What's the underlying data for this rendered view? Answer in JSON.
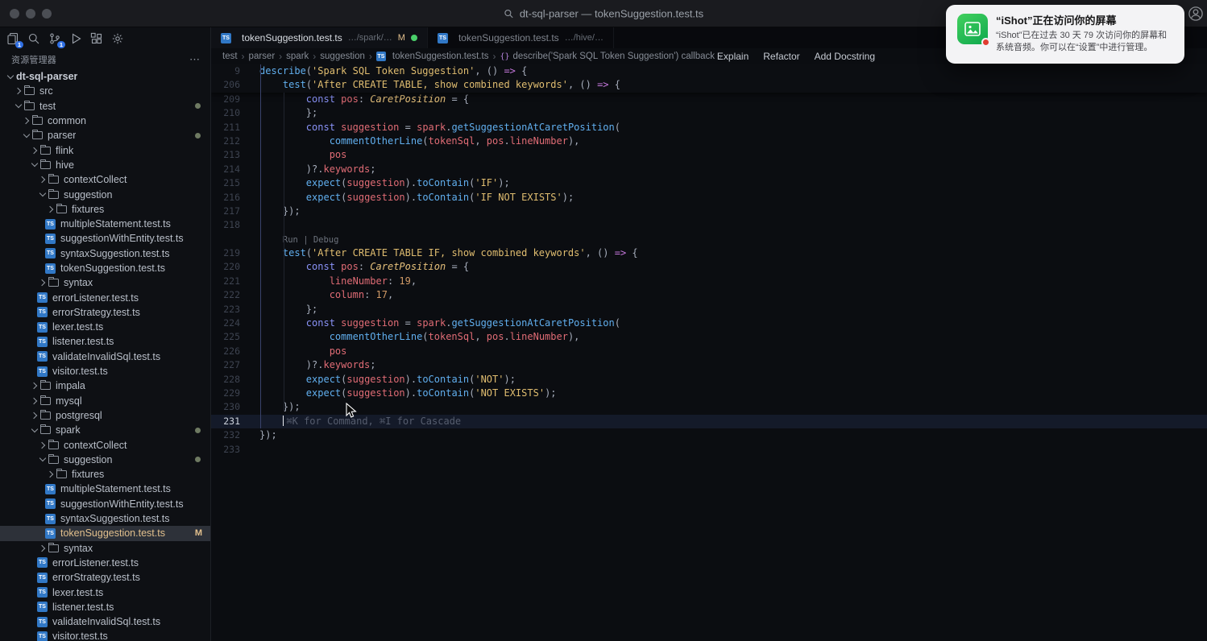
{
  "window": {
    "title": "dt-sql-parser — tokenSuggestion.test.ts"
  },
  "icons": {
    "ts_label": "TS"
  },
  "colors": {
    "accent_blue": "#2f6fe4",
    "git_modified": "#e2c08d",
    "unsaved_dot": "#4ad06a",
    "string": "#e0bd70",
    "keyword": "#8a93f8",
    "function": "#61afef",
    "variable": "#e06c75",
    "number": "#d19a66",
    "type": "#e5c07b"
  },
  "notification": {
    "title": "“iShot”正在访问你的屏幕",
    "body": "“iShot”已在过去 30 天 79 次访问你的屏幕和系统音频。你可以在“设置”中进行管理。"
  },
  "activity": {
    "icons": [
      {
        "name": "explorer-icon",
        "badge": "1"
      },
      {
        "name": "search-icon"
      },
      {
        "name": "source-control-icon",
        "badge": "1"
      },
      {
        "name": "run-debug-icon"
      },
      {
        "name": "extensions-icon"
      },
      {
        "name": "settings-icon"
      }
    ]
  },
  "sidebar": {
    "header": "资源管理器",
    "more_label": "⋯",
    "tree": [
      {
        "d": 0,
        "k": "root",
        "o": true,
        "label": "dt-sql-parser"
      },
      {
        "d": 1,
        "k": "dir",
        "o": false,
        "label": "src"
      },
      {
        "d": 1,
        "k": "dir",
        "o": true,
        "label": "test",
        "dot": true
      },
      {
        "d": 2,
        "k": "dir",
        "o": false,
        "label": "common"
      },
      {
        "d": 2,
        "k": "dir",
        "o": true,
        "label": "parser",
        "dot": true
      },
      {
        "d": 3,
        "k": "dir",
        "o": false,
        "label": "flink"
      },
      {
        "d": 3,
        "k": "dir",
        "o": true,
        "label": "hive"
      },
      {
        "d": 4,
        "k": "dir",
        "o": false,
        "label": "contextCollect"
      },
      {
        "d": 4,
        "k": "dir",
        "o": true,
        "label": "suggestion"
      },
      {
        "d": 5,
        "k": "dir",
        "o": false,
        "label": "fixtures"
      },
      {
        "d": 5,
        "k": "file",
        "label": "multipleStatement.test.ts"
      },
      {
        "d": 5,
        "k": "file",
        "label": "suggestionWithEntity.test.ts"
      },
      {
        "d": 5,
        "k": "file",
        "label": "syntaxSuggestion.test.ts"
      },
      {
        "d": 5,
        "k": "file",
        "label": "tokenSuggestion.test.ts"
      },
      {
        "d": 4,
        "k": "dir",
        "o": false,
        "label": "syntax"
      },
      {
        "d": 4,
        "k": "file",
        "label": "errorListener.test.ts"
      },
      {
        "d": 4,
        "k": "file",
        "label": "errorStrategy.test.ts"
      },
      {
        "d": 4,
        "k": "file",
        "label": "lexer.test.ts"
      },
      {
        "d": 4,
        "k": "file",
        "label": "listener.test.ts"
      },
      {
        "d": 4,
        "k": "file",
        "label": "validateInvalidSql.test.ts"
      },
      {
        "d": 4,
        "k": "file",
        "label": "visitor.test.ts"
      },
      {
        "d": 3,
        "k": "dir",
        "o": false,
        "label": "impala"
      },
      {
        "d": 3,
        "k": "dir",
        "o": false,
        "label": "mysql"
      },
      {
        "d": 3,
        "k": "dir",
        "o": false,
        "label": "postgresql"
      },
      {
        "d": 3,
        "k": "dir",
        "o": true,
        "label": "spark",
        "dot": true
      },
      {
        "d": 4,
        "k": "dir",
        "o": false,
        "label": "contextCollect"
      },
      {
        "d": 4,
        "k": "dir",
        "o": true,
        "label": "suggestion",
        "dot": true
      },
      {
        "d": 5,
        "k": "dir",
        "o": false,
        "label": "fixtures"
      },
      {
        "d": 5,
        "k": "file",
        "label": "multipleStatement.test.ts"
      },
      {
        "d": 5,
        "k": "file",
        "label": "suggestionWithEntity.test.ts"
      },
      {
        "d": 5,
        "k": "file",
        "label": "syntaxSuggestion.test.ts"
      },
      {
        "d": 5,
        "k": "file",
        "label": "tokenSuggestion.test.ts",
        "sel": true,
        "mod": true,
        "badge": "M"
      },
      {
        "d": 4,
        "k": "dir",
        "o": false,
        "label": "syntax"
      },
      {
        "d": 4,
        "k": "file",
        "label": "errorListener.test.ts"
      },
      {
        "d": 4,
        "k": "file",
        "label": "errorStrategy.test.ts"
      },
      {
        "d": 4,
        "k": "file",
        "label": "lexer.test.ts"
      },
      {
        "d": 4,
        "k": "file",
        "label": "listener.test.ts"
      },
      {
        "d": 4,
        "k": "file",
        "label": "validateInvalidSql.test.ts"
      },
      {
        "d": 4,
        "k": "file",
        "label": "visitor.test.ts"
      }
    ]
  },
  "tabs": [
    {
      "label": "tokenSuggestion.test.ts",
      "path": "…/spark/…",
      "git": "M",
      "dirty": true,
      "active": true
    },
    {
      "label": "tokenSuggestion.test.ts",
      "path": "…/hive/…",
      "active": false
    }
  ],
  "breadcrumbs": {
    "separator": "›",
    "items": [
      {
        "label": "test"
      },
      {
        "label": "parser"
      },
      {
        "label": "spark"
      },
      {
        "label": "suggestion"
      },
      {
        "label": "tokenSuggestion.test.ts",
        "icon": "ts"
      },
      {
        "label": "describe('Spark SQL Token Suggestion') callback",
        "icon": "symbol"
      }
    ],
    "actions": [
      "Explain",
      "Refactor",
      "Add Docstring"
    ]
  },
  "editor": {
    "sticky": [
      {
        "n": "9",
        "tokens": [
          [
            "f",
            "describe"
          ],
          [
            "p",
            "("
          ],
          [
            "s",
            "'Spark SQL Token Suggestion'"
          ],
          [
            "p",
            ", () "
          ],
          [
            "a",
            "=>"
          ],
          [
            "p",
            " {"
          ]
        ]
      },
      {
        "n": "206",
        "tokens": [
          [
            "p",
            "    "
          ],
          [
            "f",
            "test"
          ],
          [
            "p",
            "("
          ],
          [
            "s",
            "'After CREATE TABLE, show combined keywords'"
          ],
          [
            "p",
            ", () "
          ],
          [
            "a",
            "=>"
          ],
          [
            "p",
            " {"
          ]
        ]
      }
    ],
    "lines": [
      {
        "n": "209",
        "tokens": [
          [
            "p",
            "        "
          ],
          [
            "k",
            "const"
          ],
          [
            "p",
            " "
          ],
          [
            "v",
            "pos"
          ],
          [
            "p",
            ": "
          ],
          [
            "t",
            "CaretPosition"
          ],
          [
            "p",
            " = {"
          ]
        ]
      },
      {
        "n": "210",
        "tokens": [
          [
            "p",
            "        };"
          ]
        ]
      },
      {
        "n": "211",
        "tokens": [
          [
            "p",
            "        "
          ],
          [
            "k",
            "const"
          ],
          [
            "p",
            " "
          ],
          [
            "v",
            "suggestion"
          ],
          [
            "p",
            " = "
          ],
          [
            "v",
            "spark"
          ],
          [
            "p",
            "."
          ],
          [
            "f",
            "getSuggestionAtCaretPosition"
          ],
          [
            "p",
            "("
          ]
        ]
      },
      {
        "n": "212",
        "tokens": [
          [
            "p",
            "            "
          ],
          [
            "f",
            "commentOtherLine"
          ],
          [
            "p",
            "("
          ],
          [
            "v",
            "tokenSql"
          ],
          [
            "p",
            ", "
          ],
          [
            "v",
            "pos"
          ],
          [
            "p",
            "."
          ],
          [
            "v",
            "lineNumber"
          ],
          [
            "p",
            "),"
          ]
        ]
      },
      {
        "n": "213",
        "tokens": [
          [
            "p",
            "            "
          ],
          [
            "v",
            "pos"
          ]
        ]
      },
      {
        "n": "214",
        "tokens": [
          [
            "p",
            "        )?."
          ],
          [
            "v",
            "keywords"
          ],
          [
            "p",
            ";"
          ]
        ]
      },
      {
        "n": "215",
        "tokens": [
          [
            "p",
            "        "
          ],
          [
            "f",
            "expect"
          ],
          [
            "p",
            "("
          ],
          [
            "v",
            "suggestion"
          ],
          [
            "p",
            ")."
          ],
          [
            "f",
            "toContain"
          ],
          [
            "p",
            "("
          ],
          [
            "s",
            "'IF'"
          ],
          [
            "p",
            ");"
          ]
        ]
      },
      {
        "n": "216",
        "tokens": [
          [
            "p",
            "        "
          ],
          [
            "f",
            "expect"
          ],
          [
            "p",
            "("
          ],
          [
            "v",
            "suggestion"
          ],
          [
            "p",
            ")."
          ],
          [
            "f",
            "toContain"
          ],
          [
            "p",
            "("
          ],
          [
            "s",
            "'IF NOT EXISTS'"
          ],
          [
            "p",
            ");"
          ]
        ]
      },
      {
        "n": "217",
        "tokens": [
          [
            "p",
            "    });"
          ]
        ]
      },
      {
        "n": "218",
        "tokens": []
      },
      {
        "lens": "Run | Debug"
      },
      {
        "n": "219",
        "tokens": [
          [
            "p",
            "    "
          ],
          [
            "f",
            "test"
          ],
          [
            "p",
            "("
          ],
          [
            "s",
            "'After CREATE TABLE IF, show combined keywords'"
          ],
          [
            "p",
            ", () "
          ],
          [
            "a",
            "=>"
          ],
          [
            "p",
            " {"
          ]
        ]
      },
      {
        "n": "220",
        "tokens": [
          [
            "p",
            "        "
          ],
          [
            "k",
            "const"
          ],
          [
            "p",
            " "
          ],
          [
            "v",
            "pos"
          ],
          [
            "p",
            ": "
          ],
          [
            "t",
            "CaretPosition"
          ],
          [
            "p",
            " = {"
          ]
        ]
      },
      {
        "n": "221",
        "tokens": [
          [
            "p",
            "            "
          ],
          [
            "v",
            "lineNumber"
          ],
          [
            "p",
            ": "
          ],
          [
            "n",
            "19"
          ],
          [
            "p",
            ","
          ]
        ]
      },
      {
        "n": "222",
        "tokens": [
          [
            "p",
            "            "
          ],
          [
            "v",
            "column"
          ],
          [
            "p",
            ": "
          ],
          [
            "n",
            "17"
          ],
          [
            "p",
            ","
          ]
        ]
      },
      {
        "n": "223",
        "tokens": [
          [
            "p",
            "        };"
          ]
        ]
      },
      {
        "n": "224",
        "tokens": [
          [
            "p",
            "        "
          ],
          [
            "k",
            "const"
          ],
          [
            "p",
            " "
          ],
          [
            "v",
            "suggestion"
          ],
          [
            "p",
            " = "
          ],
          [
            "v",
            "spark"
          ],
          [
            "p",
            "."
          ],
          [
            "f",
            "getSuggestionAtCaretPosition"
          ],
          [
            "p",
            "("
          ]
        ]
      },
      {
        "n": "225",
        "tokens": [
          [
            "p",
            "            "
          ],
          [
            "f",
            "commentOtherLine"
          ],
          [
            "p",
            "("
          ],
          [
            "v",
            "tokenSql"
          ],
          [
            "p",
            ", "
          ],
          [
            "v",
            "pos"
          ],
          [
            "p",
            "."
          ],
          [
            "v",
            "lineNumber"
          ],
          [
            "p",
            "),"
          ]
        ]
      },
      {
        "n": "226",
        "tokens": [
          [
            "p",
            "            "
          ],
          [
            "v",
            "pos"
          ]
        ]
      },
      {
        "n": "227",
        "tokens": [
          [
            "p",
            "        )?."
          ],
          [
            "v",
            "keywords"
          ],
          [
            "p",
            ";"
          ]
        ]
      },
      {
        "n": "228",
        "tokens": [
          [
            "p",
            "        "
          ],
          [
            "f",
            "expect"
          ],
          [
            "p",
            "("
          ],
          [
            "v",
            "suggestion"
          ],
          [
            "p",
            ")."
          ],
          [
            "f",
            "toContain"
          ],
          [
            "p",
            "("
          ],
          [
            "s",
            "'NOT'"
          ],
          [
            "p",
            ");"
          ]
        ]
      },
      {
        "n": "229",
        "tokens": [
          [
            "p",
            "        "
          ],
          [
            "f",
            "expect"
          ],
          [
            "p",
            "("
          ],
          [
            "v",
            "suggestion"
          ],
          [
            "p",
            ")."
          ],
          [
            "f",
            "toContain"
          ],
          [
            "p",
            "("
          ],
          [
            "s",
            "'NOT EXISTS'"
          ],
          [
            "p",
            ");"
          ]
        ]
      },
      {
        "n": "230",
        "tokens": [
          [
            "p",
            "    });"
          ]
        ]
      },
      {
        "n": "231",
        "active": true,
        "cursor": true,
        "ghost": "⌘K for Command, ⌘I for Cascade",
        "tokens": [
          [
            "p",
            "    "
          ]
        ]
      },
      {
        "n": "232",
        "tokens": [
          [
            "p",
            "});"
          ]
        ]
      },
      {
        "n": "233",
        "tokens": []
      }
    ]
  }
}
